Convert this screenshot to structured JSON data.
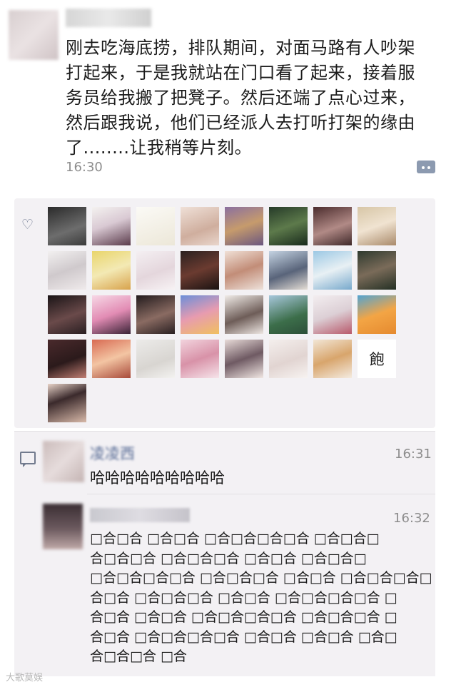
{
  "post": {
    "text": "刚去吃海底捞，排队期间，对面马路有人吵架\n打起来，于是我就站在门口看了起来，接着服\n务员给我搬了把凳子。然后还端了点心过来，\n然后跟我说，他们已经派人去打听打架的缘由\n了........让我稍等片刻。",
    "time": "16:30"
  },
  "likes": {
    "icon": "heart-icon",
    "avatars": [
      {
        "kind": "photo-man",
        "glyph": ""
      },
      {
        "kind": "anime-girl",
        "glyph": ""
      },
      {
        "kind": "bunny-sticker",
        "glyph": ""
      },
      {
        "kind": "baby-photo",
        "glyph": ""
      },
      {
        "kind": "cartoon-cat",
        "glyph": ""
      },
      {
        "kind": "plant-photo",
        "glyph": ""
      },
      {
        "kind": "girl-photo",
        "glyph": ""
      },
      {
        "kind": "anime-girl-2",
        "glyph": ""
      },
      {
        "kind": "sketch-girl",
        "glyph": ""
      },
      {
        "kind": "anime-yellow-hair",
        "glyph": ""
      },
      {
        "kind": "anime-lineart",
        "glyph": ""
      },
      {
        "kind": "bear-meme",
        "glyph": ""
      },
      {
        "kind": "crying-girl",
        "glyph": ""
      },
      {
        "kind": "anime-boy",
        "glyph": ""
      },
      {
        "kind": "anime-blue-hair",
        "glyph": ""
      },
      {
        "kind": "man-photo",
        "glyph": ""
      },
      {
        "kind": "dark-hands",
        "glyph": ""
      },
      {
        "kind": "anime-pink",
        "glyph": ""
      },
      {
        "kind": "girl-dark",
        "glyph": ""
      },
      {
        "kind": "patrick-star",
        "glyph": ""
      },
      {
        "kind": "sketch-boy",
        "glyph": ""
      },
      {
        "kind": "frog-lake",
        "glyph": ""
      },
      {
        "kind": "anime-white",
        "glyph": ""
      },
      {
        "kind": "orange-doll",
        "glyph": ""
      },
      {
        "kind": "anime-dark-hair",
        "glyph": ""
      },
      {
        "kind": "anime-red-hair",
        "glyph": ""
      },
      {
        "kind": "pale-landscape",
        "glyph": ""
      },
      {
        "kind": "pink-blur",
        "glyph": ""
      },
      {
        "kind": "anime-girl-3",
        "glyph": ""
      },
      {
        "kind": "sketch-dance",
        "glyph": ""
      },
      {
        "kind": "pomeranian",
        "glyph": ""
      },
      {
        "kind": "text-avatar",
        "glyph": "飽"
      },
      {
        "kind": "anime-woman",
        "glyph": ""
      }
    ]
  },
  "comments": [
    {
      "name": "凌凌西",
      "time": "16:31",
      "text": "哈哈哈哈哈哈哈哈哈"
    },
    {
      "name": "",
      "time": "16:32",
      "text": "□合□合 □合□合 □合□合□合□合 □合□合□\n合□合□合 □合□合□合 □合□合 □合□合□\n□合□合□合□合 □合□合□合 □合□合 □合□合□合□\n合□合 □合□合□合 □合□合 □合□合□合□合 □\n合□合 □合□合 □合□合□合□合 □合□合□合 □\n合□合 □合□合□合□合 □合□合 □合□合 □合□\n合□合□合 □合"
    }
  ],
  "watermark": "大歌莫娱"
}
